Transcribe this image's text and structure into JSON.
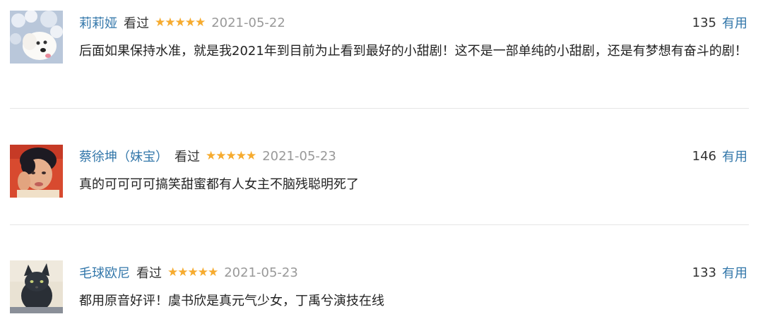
{
  "reviews": [
    {
      "username": "莉莉娅",
      "status": "看过",
      "stars": "★★★★★",
      "rating": 5,
      "date": "2021-05-22",
      "votes": "135",
      "useful_label": "有用",
      "comment": "后面如果保持水准，就是我2021年到目前为止看到最好的小甜剧！这不是一部单纯的小甜剧，还是有梦想有奋斗的剧！"
    },
    {
      "username": "蔡徐坤（妹宝）",
      "status": "看过",
      "stars": "★★★★★",
      "rating": 5,
      "date": "2021-05-23",
      "votes": "146",
      "useful_label": "有用",
      "comment": "真的可可可可搞笑甜蜜都有人女主不脑残聪明死了"
    },
    {
      "username": "毛球欧尼",
      "status": "看过",
      "stars": "★★★★★",
      "rating": 5,
      "date": "2021-05-23",
      "votes": "133",
      "useful_label": "有用",
      "comment": "都用原音好评！虞书欣是真元气少女，丁禹兮演技在线"
    }
  ],
  "colors": {
    "link": "#3377aa",
    "star": "#f6ab2f",
    "date": "#999999",
    "divider": "#e6e6e6"
  }
}
